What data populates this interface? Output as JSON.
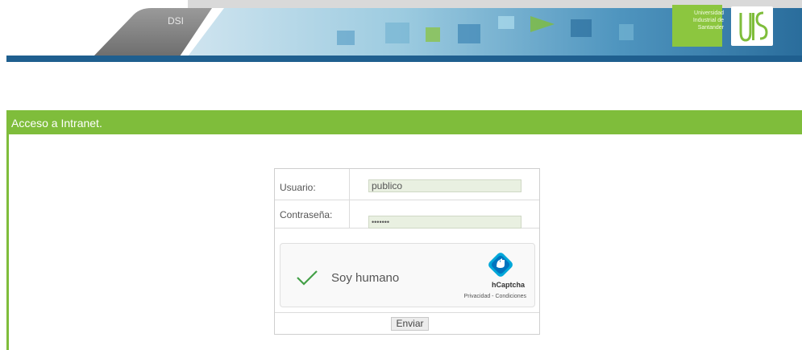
{
  "banner": {
    "tab_label": "DSI",
    "university_name": "Universidad Industrial de Santander",
    "logo_text": "UIS",
    "colors": {
      "accent": "#7fbd3b",
      "dark_blue": "#1f5f8f",
      "light_blue": "#7ab7d6"
    }
  },
  "panel": {
    "title": "Acceso a Intranet."
  },
  "form": {
    "username_label": "Usuario:",
    "username_value": "publico",
    "password_label": "Contraseña:",
    "password_value": "•••••••",
    "captcha": {
      "label": "Soy humano",
      "checked": true,
      "brand": "hCaptcha",
      "privacy_link": "Privacidad",
      "separator": " - ",
      "terms_link": "Condiciones",
      "icon": "hcaptcha-hand-icon"
    },
    "submit_label": "Enviar"
  }
}
